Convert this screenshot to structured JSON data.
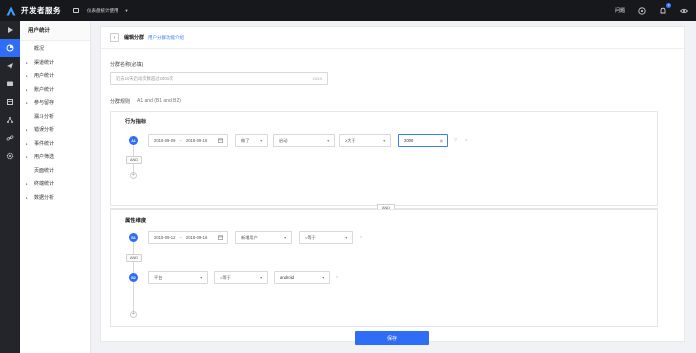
{
  "topbar": {
    "brand": "开发者服务",
    "app_name": "仪表盘统计使用",
    "doc_link": "问题",
    "notification_count": "2",
    "icons": [
      "help-icon",
      "bell-icon",
      "eye-icon"
    ]
  },
  "rail": {
    "icons": [
      "play-icon",
      "chart-pie-icon",
      "send-icon",
      "message-icon",
      "box-icon",
      "tree-icon",
      "link-icon",
      "gear-icon"
    ],
    "active_index": 1
  },
  "subnav": {
    "title": "用户统计",
    "items": [
      {
        "label": "概况",
        "arrow": false
      },
      {
        "label": "渠道统计",
        "arrow": true
      },
      {
        "label": "用户统计",
        "arrow": true
      },
      {
        "label": "账户统计",
        "arrow": true
      },
      {
        "label": "参与留存",
        "arrow": true
      },
      {
        "label": "漏斗分析",
        "arrow": false
      },
      {
        "label": "错误分析",
        "arrow": true
      },
      {
        "label": "事件统计",
        "arrow": true
      },
      {
        "label": "用户筛选",
        "arrow": true
      },
      {
        "label": "页面统计",
        "arrow": false
      },
      {
        "label": "终端统计",
        "arrow": true
      },
      {
        "label": "数据分析",
        "arrow": true
      }
    ]
  },
  "header": {
    "back_symbol": "‹",
    "title": "编辑分群",
    "breadcrumb": "用户分群功能介绍"
  },
  "form": {
    "name_label": "分群名称(必填)",
    "name_placeholder": "近去10天启动次数超过2000次",
    "name_counter": "15/10",
    "rule_label": "分群规则",
    "rule_expression": "A1 and (B1 and B2)"
  },
  "behavior": {
    "title": "行为指标",
    "row_id": "A1",
    "date_start": "2018-09-09",
    "date_end": "2018-09-16",
    "date_sep": "~",
    "aggregate": "做了",
    "event": "启动",
    "operator": "≥大于",
    "value": "2000",
    "and_label": "AND",
    "add_symbol": "+"
  },
  "connector": {
    "label": "AND"
  },
  "attribute": {
    "title": "属性维度",
    "rows": [
      {
        "id": "B1",
        "date_start": "2018-09-12",
        "date_end": "2018-09-16",
        "date_sep": "~",
        "property": "新增用户",
        "operator": "=等于"
      },
      {
        "id": "B2",
        "property": "平台",
        "operator": "=等于",
        "value": "android"
      }
    ],
    "and_label": "AND",
    "add_symbol": "+"
  },
  "actions": {
    "save_label": "保存"
  }
}
